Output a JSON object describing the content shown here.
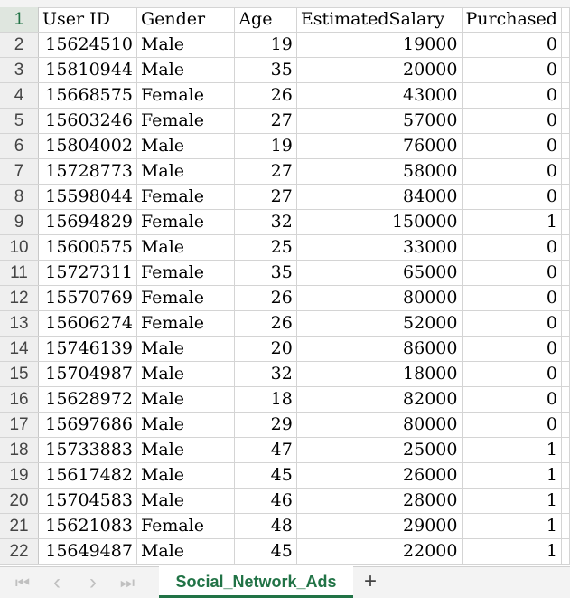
{
  "columns": [
    "User ID",
    "Gender",
    "Age",
    "EstimatedSalary",
    "Purchased"
  ],
  "header_row_number": "1",
  "rows": [
    {
      "n": "2",
      "c": [
        "15624510",
        "Male",
        "19",
        "19000",
        "0"
      ]
    },
    {
      "n": "3",
      "c": [
        "15810944",
        "Male",
        "35",
        "20000",
        "0"
      ]
    },
    {
      "n": "4",
      "c": [
        "15668575",
        "Female",
        "26",
        "43000",
        "0"
      ]
    },
    {
      "n": "5",
      "c": [
        "15603246",
        "Female",
        "27",
        "57000",
        "0"
      ]
    },
    {
      "n": "6",
      "c": [
        "15804002",
        "Male",
        "19",
        "76000",
        "0"
      ]
    },
    {
      "n": "7",
      "c": [
        "15728773",
        "Male",
        "27",
        "58000",
        "0"
      ]
    },
    {
      "n": "8",
      "c": [
        "15598044",
        "Female",
        "27",
        "84000",
        "0"
      ]
    },
    {
      "n": "9",
      "c": [
        "15694829",
        "Female",
        "32",
        "150000",
        "1"
      ]
    },
    {
      "n": "10",
      "c": [
        "15600575",
        "Male",
        "25",
        "33000",
        "0"
      ]
    },
    {
      "n": "11",
      "c": [
        "15727311",
        "Female",
        "35",
        "65000",
        "0"
      ]
    },
    {
      "n": "12",
      "c": [
        "15570769",
        "Female",
        "26",
        "80000",
        "0"
      ]
    },
    {
      "n": "13",
      "c": [
        "15606274",
        "Female",
        "26",
        "52000",
        "0"
      ]
    },
    {
      "n": "14",
      "c": [
        "15746139",
        "Male",
        "20",
        "86000",
        "0"
      ]
    },
    {
      "n": "15",
      "c": [
        "15704987",
        "Male",
        "32",
        "18000",
        "0"
      ]
    },
    {
      "n": "16",
      "c": [
        "15628972",
        "Male",
        "18",
        "82000",
        "0"
      ]
    },
    {
      "n": "17",
      "c": [
        "15697686",
        "Male",
        "29",
        "80000",
        "0"
      ]
    },
    {
      "n": "18",
      "c": [
        "15733883",
        "Male",
        "47",
        "25000",
        "1"
      ]
    },
    {
      "n": "19",
      "c": [
        "15617482",
        "Male",
        "45",
        "26000",
        "1"
      ]
    },
    {
      "n": "20",
      "c": [
        "15704583",
        "Male",
        "46",
        "28000",
        "1"
      ]
    },
    {
      "n": "21",
      "c": [
        "15621083",
        "Female",
        "48",
        "29000",
        "1"
      ]
    },
    {
      "n": "22",
      "c": [
        "15649487",
        "Male",
        "45",
        "22000",
        "1"
      ]
    }
  ],
  "tabbar": {
    "nav_first": "⏮",
    "nav_prev": "‹",
    "nav_next": "›",
    "nav_last": "⏭",
    "sheet_name": "Social_Network_Ads",
    "add_sheet": "+"
  },
  "colors": {
    "accent": "#217346",
    "grid_line": "#d4d4d4",
    "row_header_bg": "#efefef"
  },
  "icons": {
    "nav_first": "first-sheet-icon",
    "nav_prev": "previous-sheet-icon",
    "nav_next": "next-sheet-icon",
    "nav_last": "last-sheet-icon",
    "add_sheet": "plus-icon"
  }
}
